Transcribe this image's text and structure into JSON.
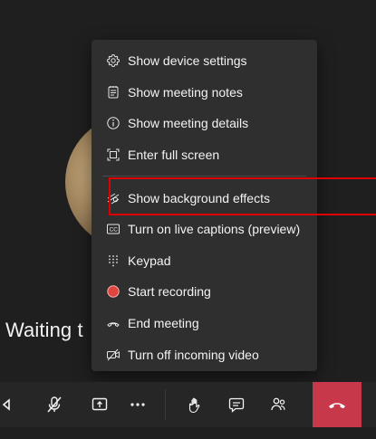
{
  "screen": {
    "waiting_text": "Waiting t"
  },
  "menu": {
    "items": [
      {
        "label": "Show device settings",
        "icon": "gear-icon"
      },
      {
        "label": "Show meeting notes",
        "icon": "notes-icon"
      },
      {
        "label": "Show meeting details",
        "icon": "info-icon"
      },
      {
        "label": "Enter full screen",
        "icon": "fullscreen-icon"
      },
      {
        "label": "Show background effects",
        "icon": "background-effects-icon"
      },
      {
        "label": "Turn on live captions (preview)",
        "icon": "captions-icon"
      },
      {
        "label": "Keypad",
        "icon": "keypad-icon"
      },
      {
        "label": "Start recording",
        "icon": "record-icon"
      },
      {
        "label": "End meeting",
        "icon": "end-meeting-icon"
      },
      {
        "label": "Turn off incoming video",
        "icon": "video-off-icon"
      }
    ]
  },
  "toolbar": {
    "buttons": [
      {
        "name": "camera-off-button",
        "icon": "camera-off-icon"
      },
      {
        "name": "mic-off-button",
        "icon": "mic-off-icon"
      },
      {
        "name": "share-button",
        "icon": "share-icon"
      },
      {
        "name": "more-actions-button",
        "icon": "more-icon"
      },
      {
        "name": "raise-hand-button",
        "icon": "hand-icon"
      },
      {
        "name": "chat-button",
        "icon": "chat-icon"
      },
      {
        "name": "participants-button",
        "icon": "people-icon"
      },
      {
        "name": "hang-up-button",
        "icon": "phone-hangup-icon"
      }
    ]
  },
  "colors": {
    "background": "#1f1f1f",
    "menu_bg": "#2f2f2f",
    "accent_red": "#c7384a",
    "highlight_red": "#e00000",
    "text": "#f3f3f3",
    "record_red": "#e0443e"
  }
}
